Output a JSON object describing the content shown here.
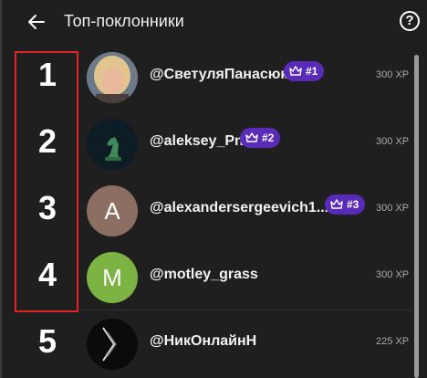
{
  "header": {
    "title": "Топ-поклонники",
    "back_icon": "arrow-left-icon",
    "help_icon": "question-circle-icon"
  },
  "fans": [
    {
      "rank": "1",
      "username": "@СветуляПанасюк",
      "badge": "#1",
      "xp": "300 XP",
      "avatar": {
        "type": "photo",
        "color": "#c8a47d"
      }
    },
    {
      "rank": "2",
      "username": "@aleksey_Pn",
      "badge": "#2",
      "xp": "300 XP",
      "avatar": {
        "type": "chess",
        "color": "#0e1f2a"
      }
    },
    {
      "rank": "3",
      "username": "@alexandersergeevich1...",
      "badge": "#3",
      "xp": "300 XP",
      "avatar": {
        "type": "letter",
        "letter": "A",
        "color": "#8d6e63"
      }
    },
    {
      "rank": "4",
      "username": "@motley_grass",
      "badge": "",
      "xp": "300 XP",
      "avatar": {
        "type": "letter",
        "letter": "M",
        "color": "#7cb342"
      }
    },
    {
      "rank": "5",
      "username": "@НикОнлайнН",
      "badge": "",
      "xp": "225 XP",
      "avatar": {
        "type": "dark-abstract",
        "color": "#111111"
      }
    }
  ],
  "colors": {
    "badge": "#5a2bb8",
    "highlight": "#e0262a",
    "background": "#1f1f1f"
  }
}
